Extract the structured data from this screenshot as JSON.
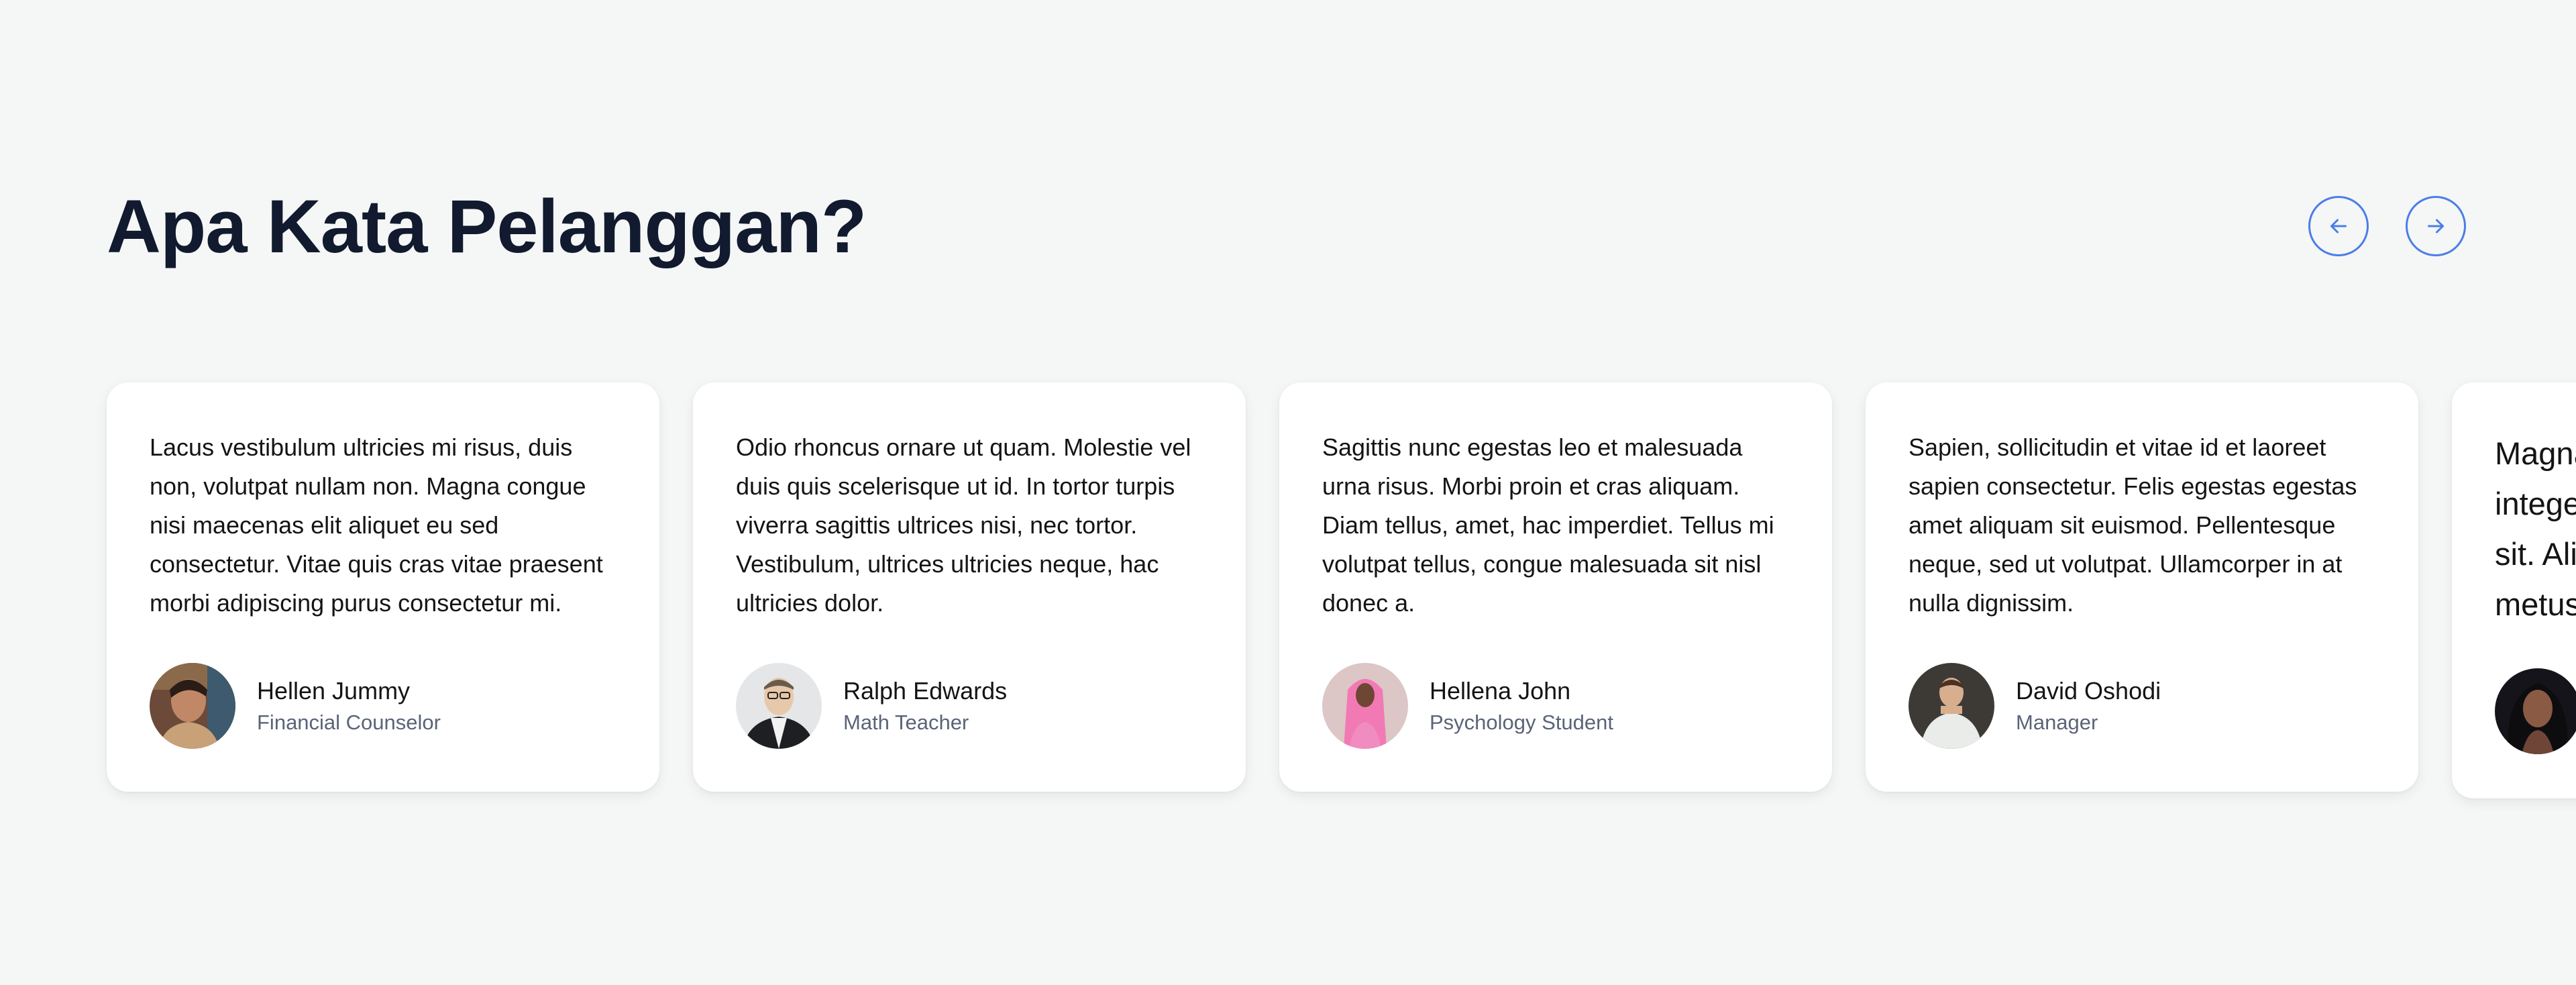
{
  "section": {
    "title": "Apa Kata Pelanggan?"
  },
  "nav": {
    "prev_icon": "arrow-left-icon",
    "next_icon": "arrow-right-icon",
    "accent_color": "#4a7ee8"
  },
  "testimonials": [
    {
      "quote": "Lacus vestibulum ultricies mi risus, duis non, volutpat nullam non. Magna congue nisi maecenas elit aliquet eu sed consectetur. Vitae quis cras vitae praesent morbi adipiscing purus consectetur mi.",
      "name": "Hellen Jummy",
      "role": "Financial Counselor"
    },
    {
      "quote": "Odio rhoncus ornare ut quam. Molestie vel duis quis scelerisque ut id. In tortor turpis viverra sagittis ultrices nisi, nec tortor. Vestibulum, ultrices ultricies neque, hac ultricies dolor.",
      "name": "Ralph Edwards",
      "role": "Math Teacher"
    },
    {
      "quote": "Sagittis nunc egestas leo et malesuada urna risus. Morbi proin et cras aliquam. Diam tellus, amet, hac imperdiet. Tellus mi volutpat tellus, congue malesuada sit nisl donec a.",
      "name": "Hellena John",
      "role": "Psychology Student"
    },
    {
      "quote": "Sapien, sollicitudin et vitae id et laoreet sapien consectetur. Felis egestas egestas amet aliquam sit euismod. Pellentesque neque, sed ut volutpat. Ullamcorper in at nulla dignissim.",
      "name": "David Oshodi",
      "role": "Manager"
    },
    {
      "quote_lines": [
        "Magna",
        "intege",
        "sit. Ali",
        "metus"
      ]
    }
  ]
}
